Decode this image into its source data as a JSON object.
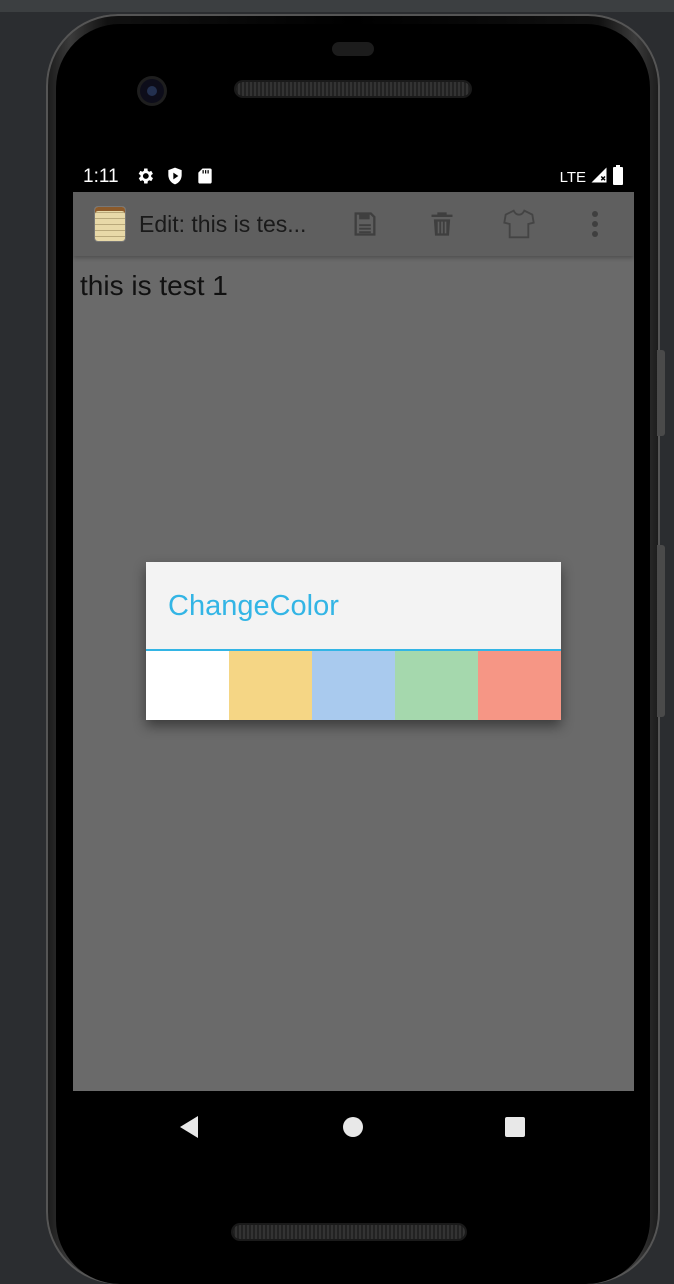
{
  "status_bar": {
    "time": "1:11",
    "network": "LTE",
    "icons": [
      "settings-icon",
      "shield-play-icon",
      "sd-card-icon",
      "signal-icon",
      "battery-icon"
    ]
  },
  "toolbar": {
    "title": "Edit: this is tes...",
    "actions": [
      "save-icon",
      "delete-icon",
      "shirt-icon",
      "more-vert-icon"
    ]
  },
  "note": {
    "text": "this is test 1"
  },
  "dialog": {
    "title": "ChangeColor",
    "accent_color": "#33b5e5",
    "swatches": [
      {
        "name": "white",
        "color": "#ffffff"
      },
      {
        "name": "yellow",
        "color": "#f5d685"
      },
      {
        "name": "blue",
        "color": "#a9caee"
      },
      {
        "name": "green",
        "color": "#a5d8ad"
      },
      {
        "name": "red",
        "color": "#f69685"
      }
    ]
  },
  "nav_bar": {
    "buttons": [
      "back-icon",
      "home-icon",
      "recents-icon"
    ]
  }
}
